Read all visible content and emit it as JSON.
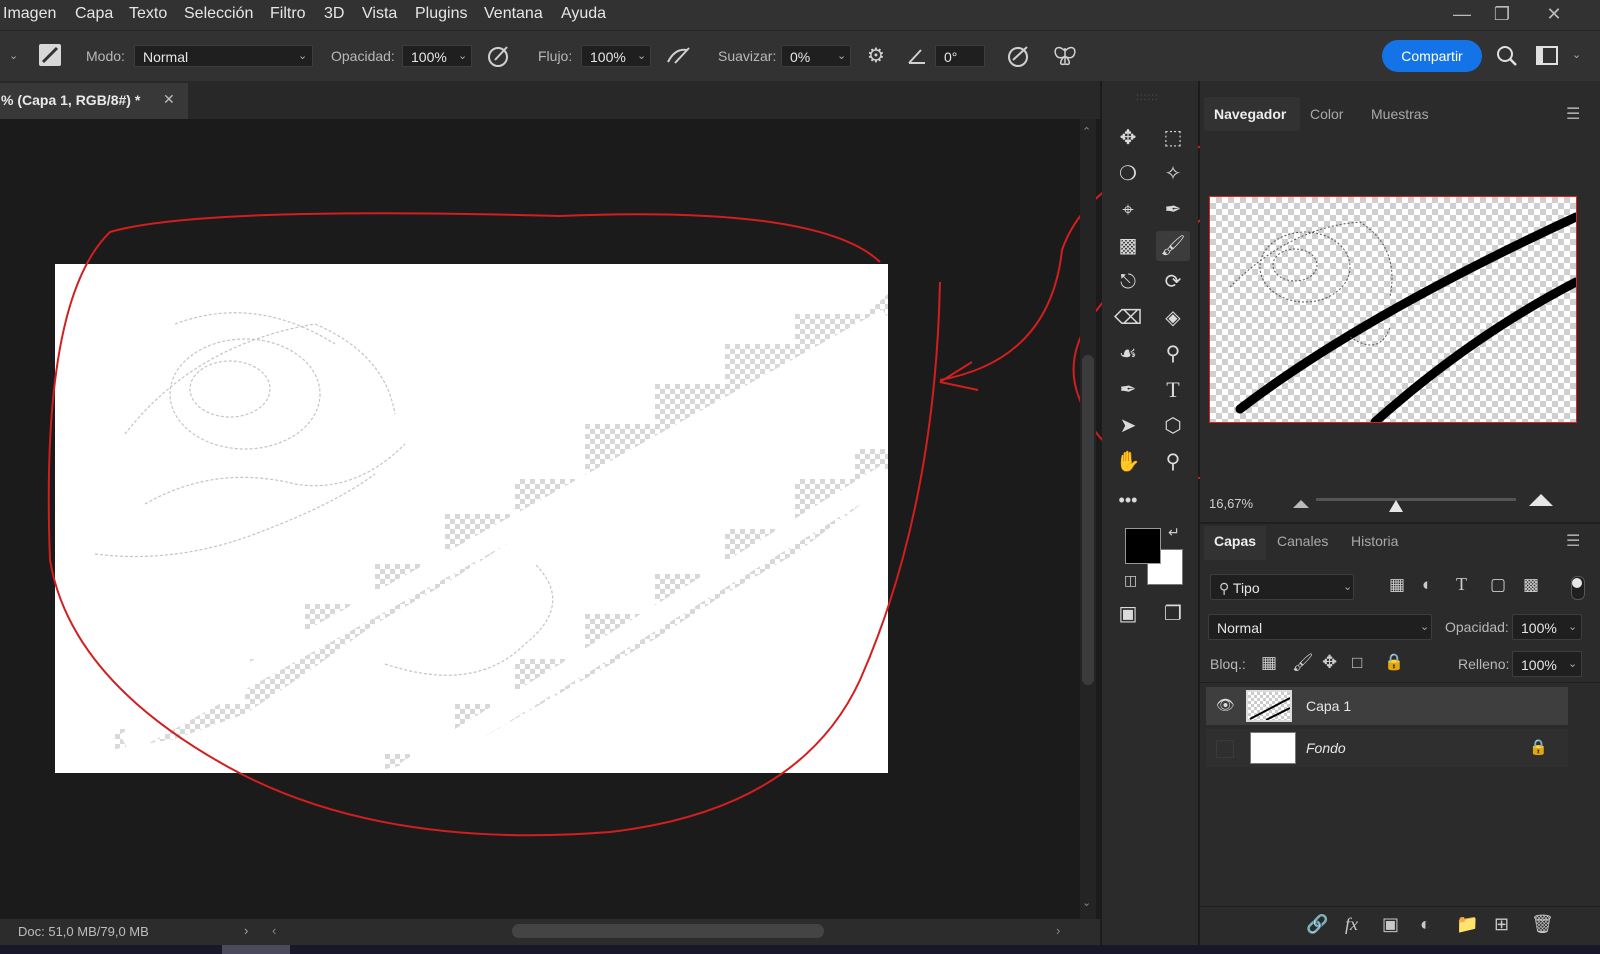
{
  "menu": [
    "Imagen",
    "Capa",
    "Texto",
    "Selección",
    "Filtro",
    "3D",
    "Vista",
    "Plugins",
    "Ventana",
    "Ayuda"
  ],
  "options": {
    "modo_label": "Modo:",
    "modo_value": "Normal",
    "opacidad_label": "Opacidad:",
    "opacidad_value": "100%",
    "flujo_label": "Flujo:",
    "flujo_value": "100%",
    "suavizar_label": "Suavizar:",
    "suavizar_value": "0%",
    "angle_value": "0°",
    "share_label": "Compartir"
  },
  "document": {
    "tab_title": "% (Capa 1, RGB/8#) *",
    "status": "Doc: 51,0 MB/79,0 MB"
  },
  "navigator": {
    "tabs": [
      "Navegador",
      "Color",
      "Muestras"
    ],
    "zoom": "16,67%"
  },
  "layers_panel": {
    "tabs": [
      "Capas",
      "Canales",
      "Historia"
    ],
    "filter_label": "Tipo",
    "blend_mode": "Normal",
    "opacity_label": "Opacidad:",
    "opacity_value": "100%",
    "lock_label": "Bloq.:",
    "fill_label": "Relleno:",
    "fill_value": "100%",
    "layers": [
      {
        "name": "Capa 1",
        "visible": true,
        "selected": true
      },
      {
        "name": "Fondo",
        "visible": false,
        "locked": true
      }
    ]
  },
  "colors": {
    "accent": "#1473e6",
    "annotation": "#d21e1e",
    "foreground": "#000000",
    "background": "#ffffff"
  }
}
